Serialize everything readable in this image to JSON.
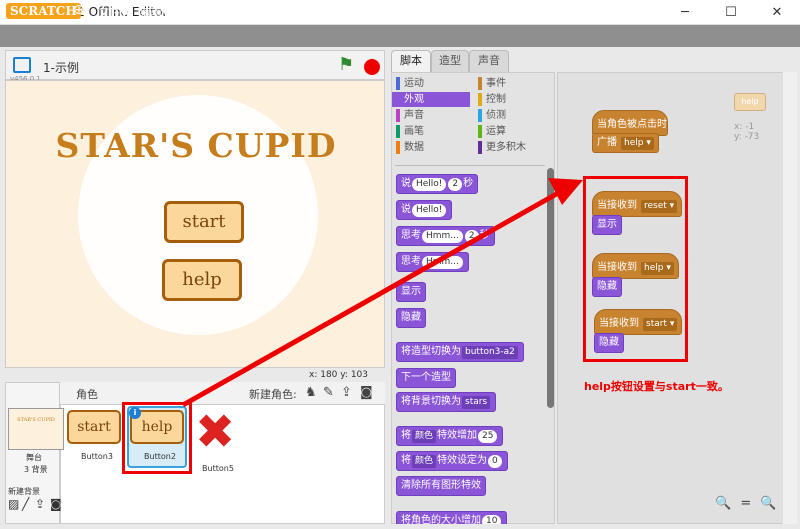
{
  "window": {
    "title": "Scratch 2 Offline Editor",
    "minimize": "─",
    "maximize": "☐",
    "close": "✕"
  },
  "menubar": {
    "logo": "SCRATCH",
    "items": [
      "文件▼",
      "编辑▼",
      "提示",
      "关于"
    ]
  },
  "stage": {
    "project_name": "1-示例",
    "version": "v456.0.1",
    "title": "STAR'S CUPID",
    "buttons": [
      "start",
      "help"
    ],
    "coords": "x: 180   y: 103"
  },
  "sprites_pane": {
    "label": "角色",
    "new_sprite_label": "新建角色:",
    "stage_thumb_label": "舞台",
    "stage_thumb_count": "3 背景",
    "new_bg_label": "新建背景",
    "sprites": [
      {
        "name": "Button3",
        "costume": "start"
      },
      {
        "name": "Button2",
        "costume": "help"
      },
      {
        "name": "Button5",
        "costume": ""
      }
    ],
    "info_badge": "i"
  },
  "tabs": [
    "脚本",
    "造型",
    "声音"
  ],
  "categories": [
    {
      "label": "运动",
      "color": "#4a6cd4"
    },
    {
      "label": "事件",
      "color": "#c88330"
    },
    {
      "label": "外观",
      "color": "#8a55d7"
    },
    {
      "label": "控制",
      "color": "#e1a91a"
    },
    {
      "label": "声音",
      "color": "#bb42c3"
    },
    {
      "label": "侦测",
      "color": "#2ca5e2"
    },
    {
      "label": "画笔",
      "color": "#0e9a6c"
    },
    {
      "label": "运算",
      "color": "#5cb712"
    },
    {
      "label": "数据",
      "color": "#ee7d16"
    },
    {
      "label": "更多积木",
      "color": "#632d99"
    }
  ],
  "palette_blocks": [
    {
      "pre": "说",
      "slot": "Hello!",
      "slot2": "2",
      "post": "秒"
    },
    {
      "pre": "说",
      "slot": "Hello!",
      "slot2": "",
      "post": ""
    },
    {
      "pre": "思考",
      "slot": "Hmm...",
      "slot2": "2",
      "post": "秒"
    },
    {
      "pre": "思考",
      "slot": "Hmm...",
      "slot2": "",
      "post": ""
    },
    {
      "pre": "显示",
      "slot": "",
      "slot2": "",
      "post": ""
    },
    {
      "pre": "隐藏",
      "slot": "",
      "slot2": "",
      "post": ""
    },
    {
      "pre": "将造型切换为",
      "dd": "button3-a2",
      "post": ""
    },
    {
      "pre": "下一个造型",
      "slot": "",
      "slot2": "",
      "post": ""
    },
    {
      "pre": "将背景切换为",
      "dd": "stars",
      "post": ""
    },
    {
      "pre": "将",
      "dd": "颜色",
      "post": "特效增加",
      "slot2": "25"
    },
    {
      "pre": "将",
      "dd": "颜色",
      "post": "特效设定为",
      "slot2": "0"
    },
    {
      "pre": "清除所有图形特效",
      "slot": "",
      "slot2": "",
      "post": ""
    },
    {
      "pre": "将角色的大小增加",
      "slot2": "10",
      "post": ""
    }
  ],
  "scripts": {
    "ghost_sprite": "help",
    "x_info": "x: -1",
    "y_info": "y: -73",
    "hat1": "当角色被点击时",
    "broadcast": "广播",
    "broadcast_value": "help",
    "hat2": "当接收到",
    "hat2_value": "reset",
    "show": "显示",
    "hat3": "当接收到",
    "hat3_value": "help",
    "hide1": "隐藏",
    "hat4": "当接收到",
    "hat4_value": "start",
    "hide2": "隐藏"
  },
  "annotation": {
    "note": "help按钮设置与start一致。"
  },
  "zoom": {
    "out": "🔍",
    "reset": "=",
    "in": "🔍"
  }
}
